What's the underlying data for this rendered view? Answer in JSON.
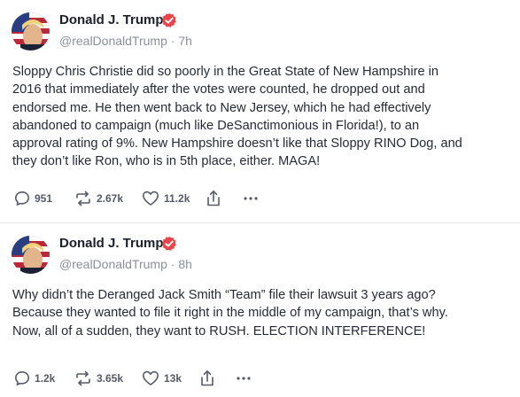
{
  "feed": {
    "posts": [
      {
        "author": {
          "display_name": "Donald J. Trump",
          "handle": "@realDonaldTrump",
          "separator": "·",
          "time": "7h"
        },
        "text": "Sloppy Chris Christie did so poorly in the Great State of New Hampshire in\n2016 that immediately after the votes were counted, he dropped out and\nendorsed me. He then went back to New Jersey, which he had effectively\nabandoned to campaign (much like DeSanctimonious in Florida!), to an\napproval rating of 9%. New Hampshire doesn’t like that Sloppy RINO Dog, and\nthey don’t like Ron, who is in 5th place, either. MAGA!",
        "actions": {
          "replies": "951",
          "retruths": "2.67k",
          "likes": "11.2k"
        }
      },
      {
        "author": {
          "display_name": "Donald J. Trump",
          "handle": "@realDonaldTrump",
          "separator": "·",
          "time": "8h"
        },
        "text": "Why didn’t the Deranged Jack Smith “Team” file their lawsuit 3 years ago?\nBecause they wanted to file it right in the middle of my campaign, that’s why.\nNow, all of a sudden, they want to RUSH. ELECTION INTERFERENCE!",
        "actions": {
          "replies": "1.2k",
          "retruths": "3.65k",
          "likes": "13k"
        }
      }
    ]
  },
  "icons": {
    "reply": "speech-bubble-icon",
    "retruth": "repost-arrows-icon",
    "like": "heart-icon",
    "share": "share-upload-icon",
    "more": "more-dots-icon",
    "verified": "verified-badge-icon"
  },
  "colors": {
    "verified_badge": "#e8454a",
    "text": "#262a35",
    "muted": "#8b8f9a",
    "action": "#555a66",
    "divider": "#e6e8ec"
  }
}
